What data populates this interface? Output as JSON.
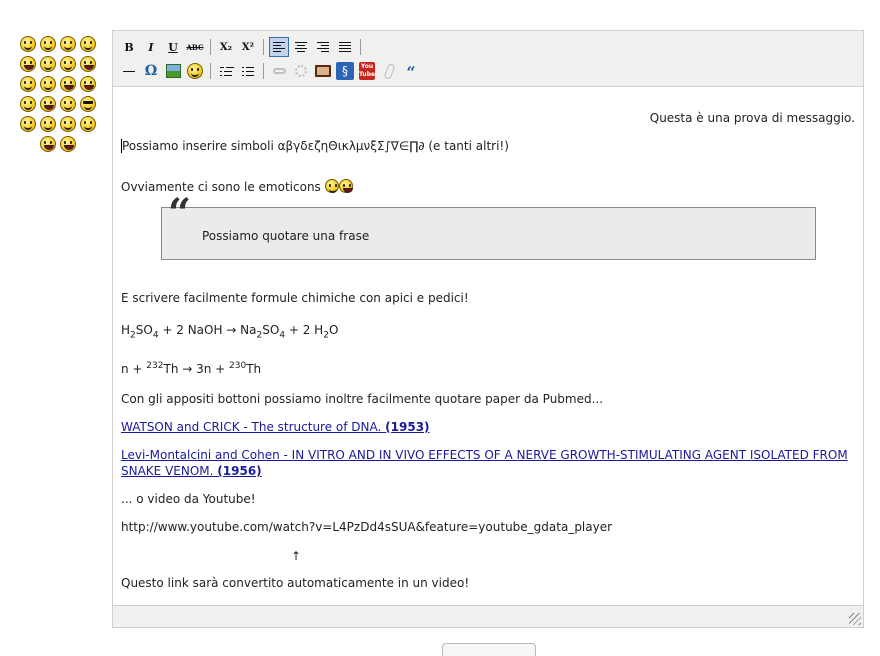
{
  "palette": {
    "rows": [
      4,
      4,
      4,
      4,
      4,
      2
    ]
  },
  "toolbar": {
    "row1": [
      "B",
      "I",
      "U",
      "ABC",
      "X₂",
      "X²"
    ],
    "row2": [
      "Ω",
      "“"
    ],
    "youtube_label": "You Tube"
  },
  "content": {
    "intro_right": "Questa è una prova di messaggio.",
    "symbols_line": "Possiamo inserire simboli αβγδεζηΘικλμνξΣ∫∇∈∏∂ (e tanti altri!)",
    "emoticons_line": "Ovviamente ci sono le emoticons",
    "quote": "Possiamo quotare una frase",
    "formulas_intro": "E scrivere facilmente formule chimiche con apici e pedici!",
    "formula1": {
      "H": "H",
      "two1": "2",
      "SO": "SO",
      "four1": "4",
      "mid": " + 2 NaOH → Na",
      "two2": "2",
      "SO2": "SO",
      "four2": "4",
      "end": " + 2 H",
      "two3": "2",
      "O": "O"
    },
    "formula2": {
      "start": "n + ",
      "sup1": "232",
      "mid": "Th → 3n + ",
      "sup2": "230",
      "end": "Th"
    },
    "pubmed_intro": "Con gli appositi bottoni possiamo inoltre facilmente quotare paper da Pubmed...",
    "link1": {
      "text": "WATSON and CRICK - The structure of DNA.",
      "year": "(1953)"
    },
    "link2": {
      "text": "Levi-Montalcini and Cohen - IN VITRO AND IN VIVO EFFECTS OF A NERVE GROWTH-STIMULATING AGENT ISOLATED FROM SNAKE VENOM.",
      "year": "(1956)"
    },
    "video_intro": "... o video da Youtube!",
    "video_url": "http://www.youtube.com/watch?v=L4PzDd4sSUA&feature=youtube_gdata_player",
    "arrow": "↑",
    "convert_note": "Questo link sarà convertito automaticamente in un video!"
  },
  "colors": {
    "toolbar_bg": "#f0f0ee",
    "link": "#1a1a9c",
    "quote_bg": "#ebebeb",
    "active_button": "#c2d3ef"
  }
}
